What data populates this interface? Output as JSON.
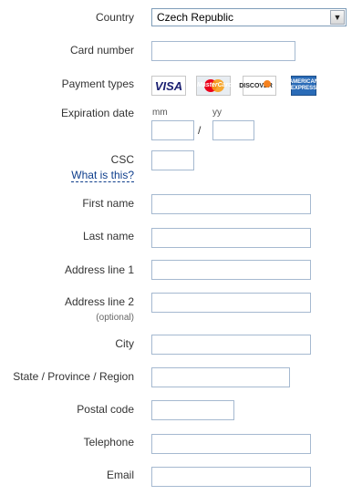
{
  "form": {
    "country": {
      "label": "Country",
      "value": "Czech Republic"
    },
    "card_number": {
      "label": "Card number",
      "value": ""
    },
    "payment_types": {
      "label": "Payment types",
      "cards": [
        "VISA",
        "MasterCard",
        "DISCOVER",
        "AMERICAN EXPRESS"
      ]
    },
    "expiration": {
      "label": "Expiration date",
      "mm_label": "mm",
      "yy_label": "yy",
      "separator": "/",
      "mm_value": "",
      "yy_value": ""
    },
    "csc": {
      "label": "CSC",
      "help_link": "What is this?",
      "value": ""
    },
    "first_name": {
      "label": "First name",
      "value": ""
    },
    "last_name": {
      "label": "Last name",
      "value": ""
    },
    "address_line_1": {
      "label": "Address line 1",
      "value": ""
    },
    "address_line_2": {
      "label": "Address line 2",
      "note": "(optional)",
      "value": ""
    },
    "city": {
      "label": "City",
      "value": ""
    },
    "state": {
      "label": "State / Province / Region",
      "value": ""
    },
    "postal_code": {
      "label": "Postal code",
      "value": ""
    },
    "telephone": {
      "label": "Telephone",
      "value": ""
    },
    "email": {
      "label": "Email",
      "value": ""
    }
  },
  "colors": {
    "label_text": "#333333",
    "link": "#0e3e8c",
    "input_border": "#a5b9d0"
  }
}
